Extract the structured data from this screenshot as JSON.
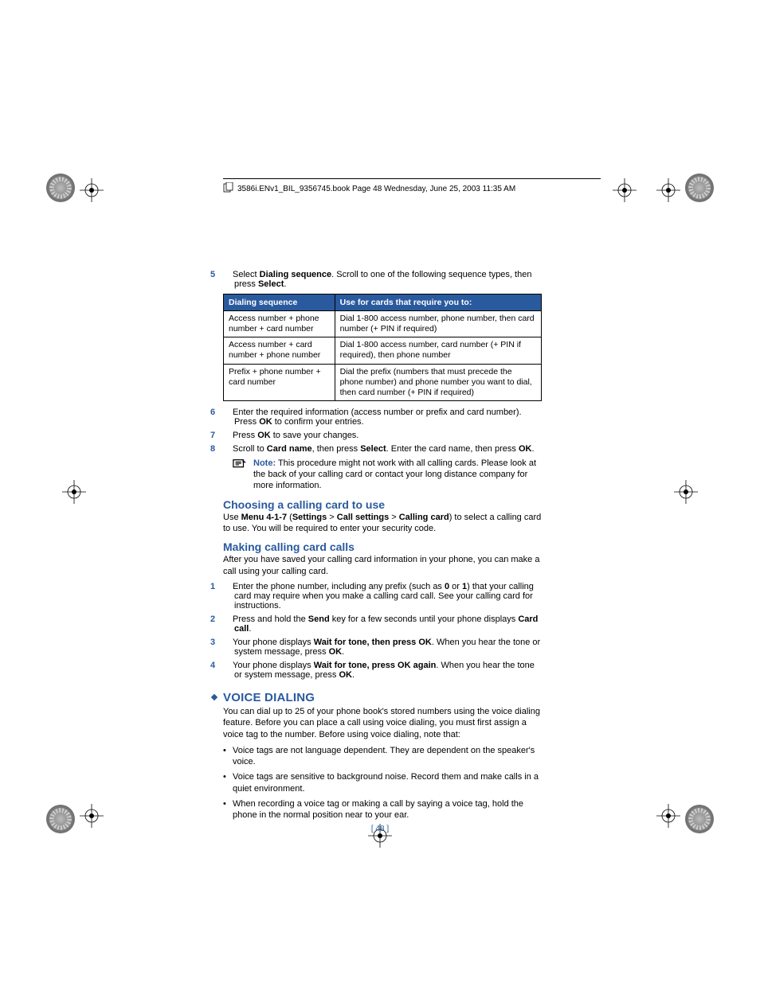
{
  "header": {
    "text": "3586i.ENv1_BIL_9356745.book  Page 48  Wednesday, June 25, 2003  11:35 AM"
  },
  "step5": {
    "num": "5",
    "prefix": "Select ",
    "b1": "Dialing sequence",
    "mid": ". Scroll to one of the following sequence types, then press ",
    "b2": "Select",
    "suffix": "."
  },
  "table": {
    "h1": "Dialing sequence",
    "h2": "Use for cards that require you to:",
    "r1c1": "Access number + phone number + card number",
    "r1c2": "Dial 1-800 access number, phone number, then card number (+ PIN if required)",
    "r2c1": "Access number + card number + phone number",
    "r2c2": "Dial 1-800 access number, card number (+ PIN if required), then phone number",
    "r3c1": "Prefix + phone number + card number",
    "r3c2": "Dial the prefix (numbers that must precede the phone number) and phone number you want to dial, then card number (+ PIN if required)"
  },
  "step6": {
    "num": "6",
    "a": "Enter the required information (access number or prefix and card number). Press ",
    "b": "OK",
    "c": " to confirm your entries."
  },
  "step7": {
    "num": "7",
    "a": "Press ",
    "b": "OK",
    "c": " to save your changes."
  },
  "step8": {
    "num": "8",
    "a": "Scroll to ",
    "b1": "Card name",
    "c": ", then press ",
    "b2": "Select",
    "d": ". Enter the card name, then press ",
    "b3": "OK",
    "e": "."
  },
  "note": {
    "label": "Note:",
    "text": " This procedure might not work with all calling cards. Please look at the back of your calling card or contact your long distance company for more information."
  },
  "h_choose": "Choosing a calling card to use",
  "choose": {
    "a": "Use ",
    "b1": "Menu 4-1-7",
    "c": " (",
    "b2": "Settings",
    "gt1": " > ",
    "b3": "Call settings",
    "gt2": " > ",
    "b4": "Calling card",
    "d": ") to select a calling card to use. You will be required to enter your security code."
  },
  "h_making": "Making calling card calls",
  "making_intro": "After you have saved your calling card information in your phone, you can make a call using your calling card.",
  "m1": {
    "num": "1",
    "a": "Enter the phone number, including any prefix (such as ",
    "b1": "0",
    "c": " or ",
    "b2": "1",
    "d": ") that your calling card may require when you make a calling card call. See your calling card for instructions."
  },
  "m2": {
    "num": "2",
    "a": "Press and hold the ",
    "b1": "Send",
    "c": " key for a few seconds until your phone displays ",
    "b2": "Card call",
    "d": "."
  },
  "m3": {
    "num": "3",
    "a": "Your phone displays ",
    "b1": "Wait for tone, then press OK",
    "c": ". When you hear the tone or system message, press ",
    "b2": "OK",
    "d": "."
  },
  "m4": {
    "num": "4",
    "a": "Your phone displays ",
    "b1": "Wait for tone, press OK again",
    "c": ". When you hear the tone or system message, press ",
    "b2": "OK",
    "d": "."
  },
  "section_voice": "VOICE DIALING",
  "voice_intro": "You can dial up to 25 of your phone book's stored numbers using the voice dialing feature. Before you can place a call using voice dialing, you must first assign a voice tag to the number. Before using voice dialing, note that:",
  "vb1": "Voice tags are not language dependent. They are dependent on the speaker's voice.",
  "vb2": "Voice tags are sensitive to background noise. Record them and make calls in a quiet environment.",
  "vb3": "When recording a voice tag or making a call by saying a voice tag, hold the phone in the normal position near to your ear.",
  "page_num": "[ 48 ]"
}
